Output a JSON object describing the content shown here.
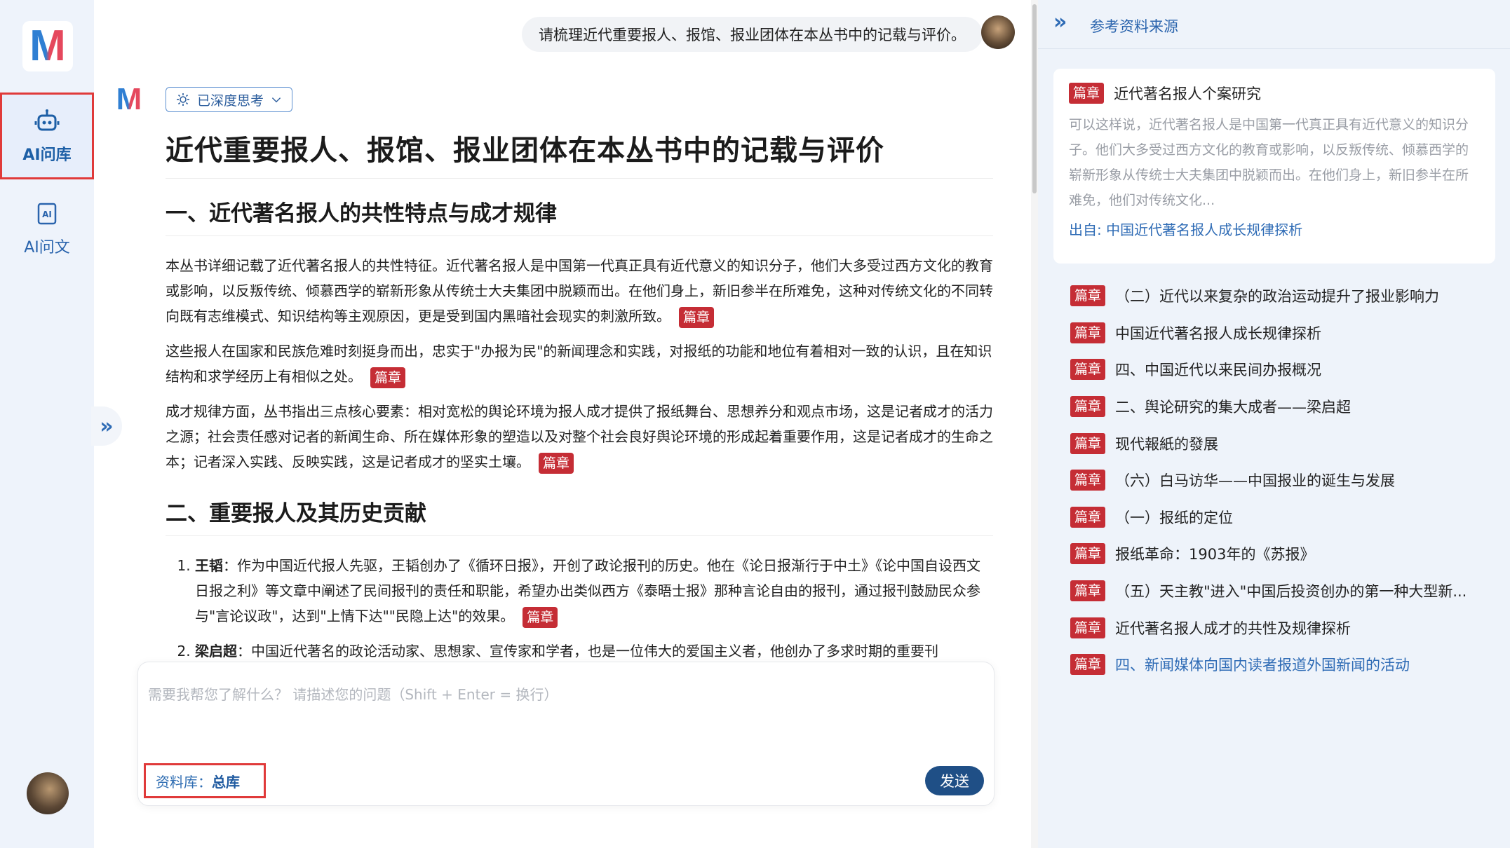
{
  "sidebar": {
    "logo": "M",
    "items": [
      {
        "label": "AI问库",
        "icon": "robot-icon",
        "active": true
      },
      {
        "label": "AI问文",
        "icon": "ai-doc-icon",
        "active": false
      }
    ]
  },
  "chat": {
    "user_message": "请梳理近代重要报人、报馆、报业团体在本丛书中的记载与评价。",
    "think_badge": "已深度思考",
    "title": "近代重要报人、报馆、报业团体在本丛书中的记载与评价",
    "section1": {
      "heading": "一、近代著名报人的共性特点与成才规律",
      "paragraphs": [
        "本丛书详细记载了近代著名报人的共性特征。近代著名报人是中国第一代真正具有近代意义的知识分子，他们大多受过西方文化的教育或影响，以反叛传统、倾慕西学的崭新形象从传统士大夫集团中脱颖而出。在他们身上，新旧参半在所难免，这种对传统文化的不同转向既有志维模式、知识结构等主观原因，更是受到国内黑暗社会现实的刺激所致。",
        "这些报人在国家和民族危难时刻挺身而出，忠实于\"办报为民\"的新闻理念和实践，对报纸的功能和地位有着相对一致的认识，且在知识结构和求学经历上有相似之处。",
        "成才规律方面，丛书指出三点核心要素：相对宽松的舆论环境为报人成才提供了报纸舞台、思想养分和观点市场，这是记者成才的活力之源；社会责任感对记者的新闻生命、所在媒体形象的塑造以及对整个社会良好舆论环境的形成起着重要作用，这是记者成才的生命之本；记者深入实践、反映实践，这是记者成才的坚实土壤。"
      ]
    },
    "section2": {
      "heading": "二、重要报人及其历史贡献",
      "items": [
        {
          "name": "王韬",
          "text": "：作为中国近代报人先驱，王韬创办了《循环日报》，开创了政论报刊的历史。他在《论日报渐行于中土》《论中国自设西文日报之利》等文章中阐述了民间报刊的责任和职能，希望办出类似西方《泰晤士报》那种言论自由的报刊，通过报刊鼓励民众参与\"言论议政\"，达到\"上情下达\"\"民隐上达\"的效果。"
        },
        {
          "name": "梁启超",
          "text": "：中国近代著名的政论活动家、思想家、宣传家和学者，也是一位伟大的爱国主义者，他创办了多求时期的重要刊"
        }
      ]
    },
    "ref_tag": "篇章"
  },
  "input": {
    "placeholder": "需要我帮您了解什么？ 请描述您的问题（Shift + Enter = 换行）",
    "value": "",
    "library_label": "资料库：",
    "library_value": "总库",
    "send_label": "发送"
  },
  "references": {
    "title": "参考资料来源",
    "tag": "篇章",
    "featured": {
      "title": "近代著名报人个案研究",
      "excerpt": "可以这样说，近代著名报人是中国第一代真正具有近代意义的知识分子。他们大多受过西方文化的教育或影响，以反叛传统、倾慕西学的崭新形象从传统士大夫集团中脱颖而出。在他们身上，新旧参半在所难免，他们对传统文化...",
      "source": "出自: 中国近代著名报人成长规律探析"
    },
    "items": [
      {
        "title": "（二）近代以来复杂的政治运动提升了报业影响力",
        "link": false
      },
      {
        "title": "中国近代著名报人成长规律探析",
        "link": false
      },
      {
        "title": "四、中国近代以来民间办报概况",
        "link": false
      },
      {
        "title": "二、舆论研究的集大成者——梁启超",
        "link": false
      },
      {
        "title": "现代報紙的發展",
        "link": false
      },
      {
        "title": "（六）白马访华——中国报业的诞生与发展",
        "link": false
      },
      {
        "title": "（一）报纸的定位",
        "link": false
      },
      {
        "title": "报纸革命：1903年的《苏报》",
        "link": false
      },
      {
        "title": "（五）天主教\"进入\"中国后投资创办的第一种大型新...",
        "link": false
      },
      {
        "title": "近代著名报人成才的共性及规律探析",
        "link": false
      },
      {
        "title": "四、新闻媒体向国内读者报道外国新闻的活动",
        "link": true
      }
    ]
  },
  "colors": {
    "accent_blue": "#1f4f86",
    "tag_red": "#c52d35",
    "highlight_red": "#e03a3a",
    "panel_bg": "#eef3fa"
  }
}
